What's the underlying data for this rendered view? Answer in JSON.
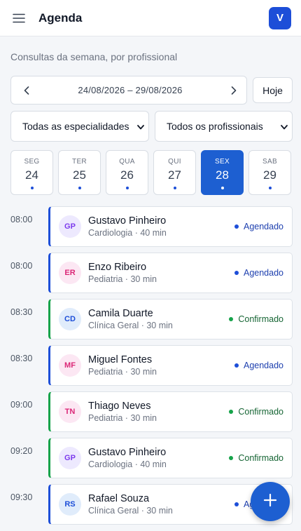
{
  "header": {
    "title": "Agenda",
    "avatar_letter": "V"
  },
  "subtitle": "Consultas da semana, por profissional",
  "range": {
    "text": "24/08/2026 – 29/08/2026",
    "today_label": "Hoje"
  },
  "filters": {
    "specialty": "Todas as especialidades",
    "professional": "Todos os profissionais"
  },
  "days": [
    {
      "name": "SEG",
      "num": "24",
      "active": false
    },
    {
      "name": "TER",
      "num": "25",
      "active": false
    },
    {
      "name": "QUA",
      "num": "26",
      "active": false
    },
    {
      "name": "QUI",
      "num": "27",
      "active": false
    },
    {
      "name": "SEX",
      "num": "28",
      "active": true
    },
    {
      "name": "SAB",
      "num": "29",
      "active": false
    }
  ],
  "appointments": [
    {
      "time": "08:00",
      "initials": "GP",
      "name": "Gustavo Pinheiro",
      "meta": "Cardiologia · 40 min",
      "status": "Agendado",
      "kind": "booked",
      "avatar_bg": "#ede9fe",
      "avatar_fg": "#7c3aed"
    },
    {
      "time": "08:00",
      "initials": "ER",
      "name": "Enzo Ribeiro",
      "meta": "Pediatria · 30 min",
      "status": "Agendado",
      "kind": "booked",
      "avatar_bg": "#fce7f3",
      "avatar_fg": "#db2777"
    },
    {
      "time": "08:30",
      "initials": "CD",
      "name": "Camila Duarte",
      "meta": "Clínica Geral · 30 min",
      "status": "Confirmado",
      "kind": "conf",
      "avatar_bg": "#e0ecfb",
      "avatar_fg": "#1d4ed8"
    },
    {
      "time": "08:30",
      "initials": "MF",
      "name": "Miguel Fontes",
      "meta": "Pediatria · 30 min",
      "status": "Agendado",
      "kind": "booked",
      "avatar_bg": "#fce7f3",
      "avatar_fg": "#db2777"
    },
    {
      "time": "09:00",
      "initials": "TN",
      "name": "Thiago Neves",
      "meta": "Pediatria · 30 min",
      "status": "Confirmado",
      "kind": "conf",
      "avatar_bg": "#fce7f3",
      "avatar_fg": "#db2777"
    },
    {
      "time": "09:20",
      "initials": "GP",
      "name": "Gustavo Pinheiro",
      "meta": "Cardiologia · 40 min",
      "status": "Confirmado",
      "kind": "conf",
      "avatar_bg": "#ede9fe",
      "avatar_fg": "#7c3aed"
    },
    {
      "time": "09:30",
      "initials": "RS",
      "name": "Rafael Souza",
      "meta": "Clínica Geral · 30 min",
      "status": "Agendado",
      "kind": "booked",
      "avatar_bg": "#e0ecfb",
      "avatar_fg": "#1d4ed8"
    }
  ],
  "colors": {
    "accent": "#1d5fd1",
    "booked": "#1d4ed8",
    "confirmed": "#16a34a"
  },
  "icons": {
    "menu": "menu-icon",
    "prev": "chevron-left-icon",
    "next": "chevron-right-icon",
    "add": "plus-icon",
    "dropdown": "chevron-down-icon"
  }
}
